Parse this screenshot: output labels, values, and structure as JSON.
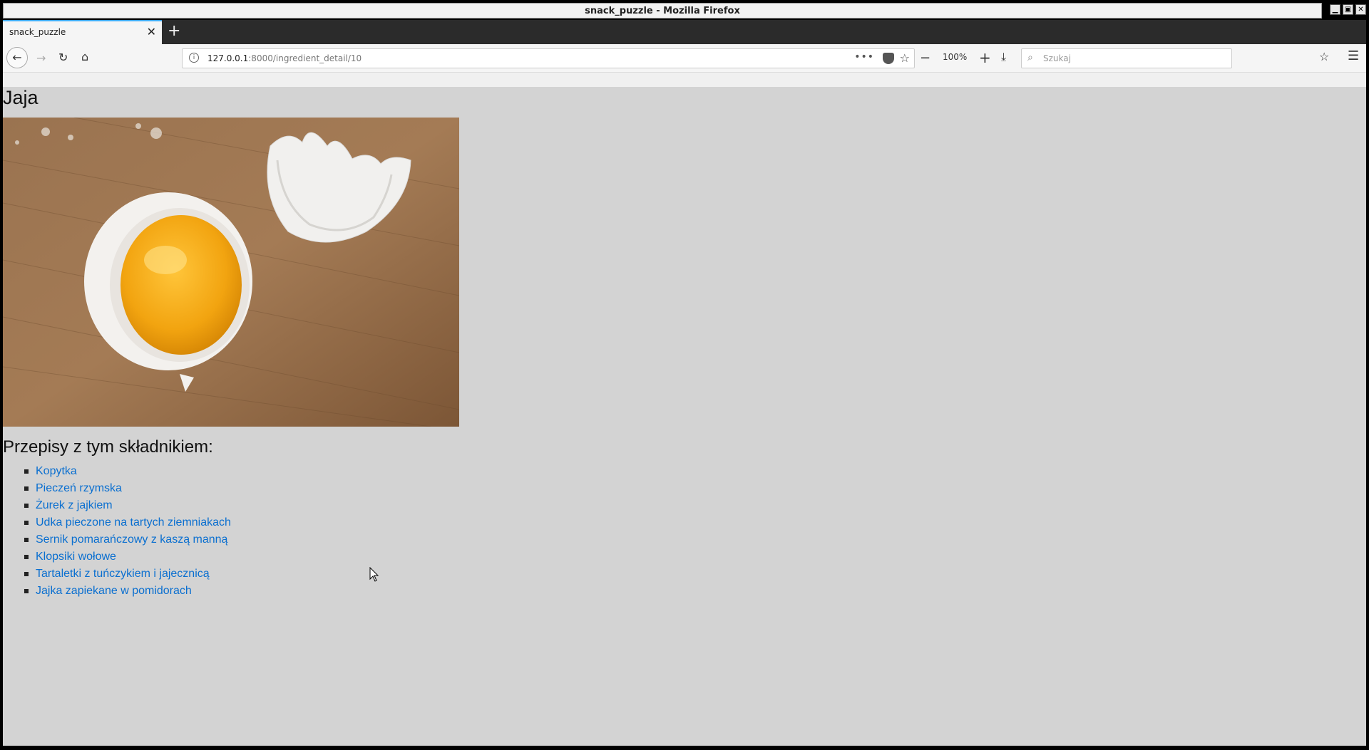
{
  "window": {
    "title": "snack_puzzle - Mozilla Firefox"
  },
  "tab": {
    "title": "snack_puzzle"
  },
  "nav": {
    "url_host": "127.0.0.1",
    "url_path": ":8000/ingredient_detail/10",
    "zoom": "100%",
    "search_placeholder": "Szukaj"
  },
  "page": {
    "title": "Jaja",
    "recipes_heading": "Przepisy z tym składnikiem:",
    "recipes": [
      "Kopytka",
      "Pieczeń rzymska",
      "Żurek z jajkiem",
      "Udka pieczone na tartych ziemniakach",
      "Sernik pomarańczowy z kaszą manną",
      "Klopsiki wołowe",
      "Tartaletki z tuńczykiem i jajecznicą",
      "Jajka zapiekane w pomidorach"
    ]
  },
  "colors": {
    "link": "#0a6fd0",
    "page_bg": "#d3d3d3",
    "tab_accent": "#3fa9f5"
  }
}
